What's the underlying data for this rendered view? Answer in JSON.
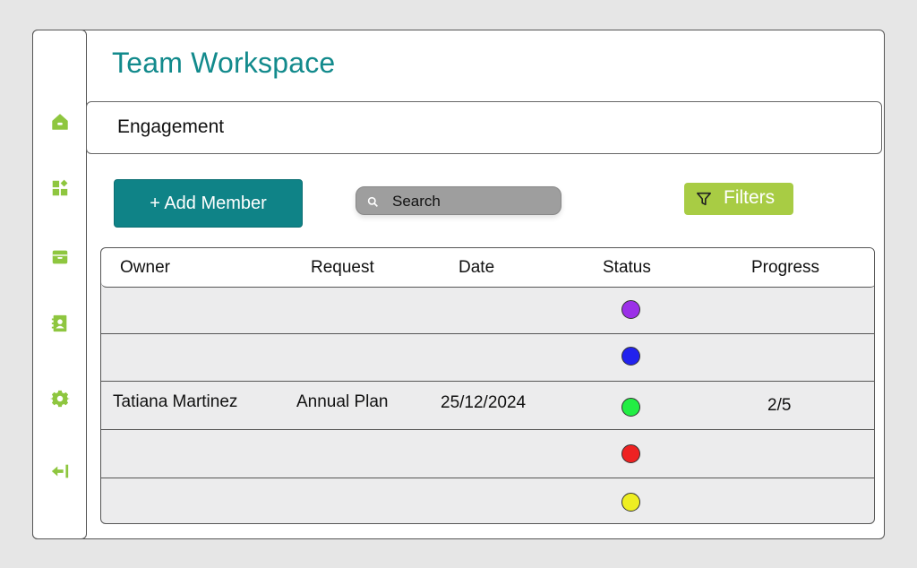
{
  "app": {
    "title": "Team Workspace"
  },
  "tabs": [
    {
      "label": "Engagement"
    }
  ],
  "sidebar": {
    "items": [
      {
        "icon": "home-icon"
      },
      {
        "icon": "dashboard-icon"
      },
      {
        "icon": "archive-icon"
      },
      {
        "icon": "contacts-icon"
      },
      {
        "icon": "gear-icon"
      },
      {
        "icon": "logout-icon"
      }
    ],
    "accent": "#8ec63f"
  },
  "toolbar": {
    "add_member_label": "+ Add Member",
    "search_placeholder": "Search",
    "filters_label": "Filters"
  },
  "table": {
    "columns": [
      "Owner",
      "Request",
      "Date",
      "Status",
      "Progress"
    ],
    "rows": [
      {
        "owner": "",
        "request": "",
        "date": "",
        "status_color": "#9b30e8",
        "progress": ""
      },
      {
        "owner": "",
        "request": "",
        "date": "",
        "status_color": "#2222ee",
        "progress": ""
      },
      {
        "owner": "Tatiana Martinez",
        "request": "Annual Plan",
        "date": "25/12/2024",
        "status_color": "#22ee44",
        "progress": "2/5"
      },
      {
        "owner": "",
        "request": "",
        "date": "",
        "status_color": "#ee2222",
        "progress": ""
      },
      {
        "owner": "",
        "request": "",
        "date": "",
        "status_color": "#eeee22",
        "progress": ""
      }
    ]
  },
  "colors": {
    "brand_teal": "#0f8387",
    "title_teal": "#128a8c",
    "filters_green": "#a8cc44"
  }
}
